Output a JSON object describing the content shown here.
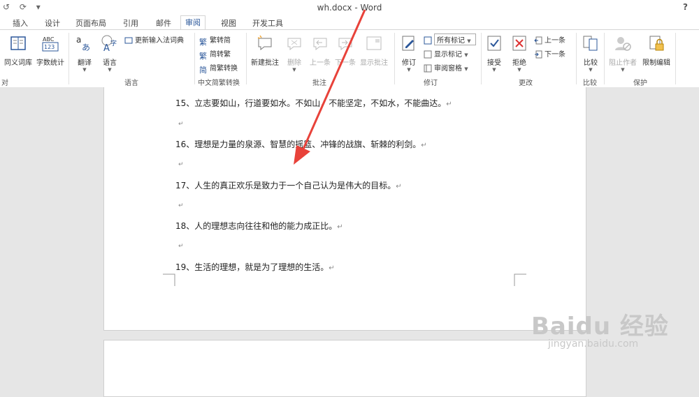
{
  "window": {
    "title": "wh.docx - Word",
    "help": "?"
  },
  "qat": {
    "undo": "↺",
    "redo": "⟳",
    "customize": "▾"
  },
  "tabs": [
    "插入",
    "设计",
    "页面布局",
    "引用",
    "邮件",
    "审阅",
    "视图",
    "开发工具"
  ],
  "active_tab": "审阅",
  "ribbon": {
    "proofing": {
      "thesaurus": "同义词库",
      "word_count": "字数统计",
      "label_partial": "对"
    },
    "language": {
      "translate": "翻译",
      "language": "语言",
      "update_ime": "更新输入法词典",
      "label": "语言"
    },
    "chinese": {
      "to_trad": "繁转简",
      "to_simp": "简转繁",
      "convert": "简繁转换",
      "label": "中文简繁转换"
    },
    "comments": {
      "new": "新建批注",
      "delete": "删除",
      "prev": "上一条",
      "next": "下一条",
      "show": "显示批注",
      "label": "批注"
    },
    "tracking": {
      "track": "修订",
      "markup": "所有标记",
      "show_markup": "显示标记",
      "pane": "审阅窗格",
      "label": "修订"
    },
    "changes": {
      "accept": "接受",
      "reject": "拒绝",
      "prev": "上一条",
      "next": "下一条",
      "label": "更改"
    },
    "compare": {
      "compare": "比较",
      "label": "比较"
    },
    "protect": {
      "block": "阻止作者",
      "restrict": "限制编辑",
      "label": "保护"
    }
  },
  "document": {
    "lines": [
      "15、立志要如山，行道要如水。不如山，不能坚定，不如水，不能曲达。",
      "16、理想是力量的泉源、智慧的摇篮、冲锋的战旗、斩棘的利剑。",
      "17、人生的真正欢乐是致力于一个自己认为是伟大的目标。",
      "18、人的理想志向往往和他的能力成正比。",
      "19、生活的理想，就是为了理想的生活。"
    ],
    "para_mark": "↵"
  },
  "watermark": {
    "logo": "Baidu 经验",
    "url": "jingyan.baidu.com"
  }
}
